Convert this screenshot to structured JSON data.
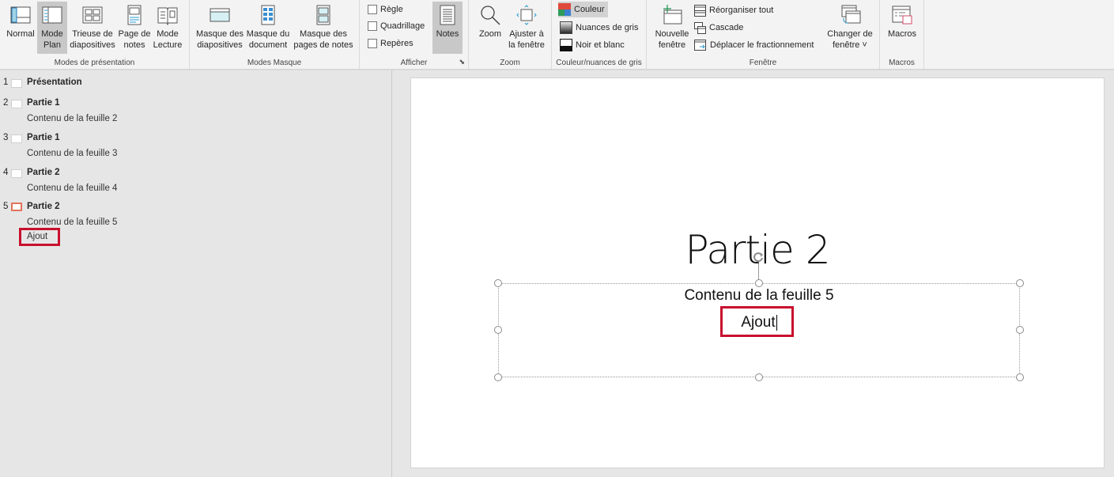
{
  "ribbon": {
    "groups": {
      "presentation_modes": {
        "label": "Modes de présentation",
        "buttons": [
          {
            "id": "normal",
            "line1": "Normal",
            "line2": "",
            "icon": "normal-view-icon",
            "active": false
          },
          {
            "id": "plan",
            "line1": "Mode",
            "line2": "Plan",
            "icon": "outline-view-icon",
            "active": true
          },
          {
            "id": "sorter",
            "line1": "Trieuse de",
            "line2": "diapositives",
            "icon": "slide-sorter-icon",
            "active": false
          },
          {
            "id": "notes_page",
            "line1": "Page de",
            "line2": "notes",
            "icon": "notes-page-icon",
            "active": false
          },
          {
            "id": "reading",
            "line1": "Mode",
            "line2": "Lecture",
            "icon": "reading-view-icon",
            "active": false
          }
        ]
      },
      "master_modes": {
        "label": "Modes Masque",
        "buttons": [
          {
            "id": "slide_master",
            "line1": "Masque des",
            "line2": "diapositives",
            "icon": "slide-master-icon"
          },
          {
            "id": "handout_master",
            "line1": "Masque du",
            "line2": "document",
            "icon": "handout-master-icon"
          },
          {
            "id": "notes_master",
            "line1": "Masque des",
            "line2": "pages de notes",
            "icon": "notes-master-icon"
          }
        ]
      },
      "show": {
        "label": "Afficher",
        "checkboxes": [
          {
            "id": "ruler",
            "label": "Règle",
            "checked": false
          },
          {
            "id": "gridlines",
            "label": "Quadrillage",
            "checked": false
          },
          {
            "id": "guides",
            "label": "Repères",
            "checked": false
          }
        ],
        "notes_button": {
          "label": "Notes",
          "icon": "notes-icon",
          "active": true
        }
      },
      "zoom": {
        "label": "Zoom",
        "buttons": [
          {
            "id": "zoom",
            "line1": "Zoom",
            "line2": "",
            "icon": "magnifier-icon"
          },
          {
            "id": "fit",
            "line1": "Ajuster à",
            "line2": "la fenêtre",
            "icon": "fit-window-icon"
          }
        ]
      },
      "color": {
        "label": "Couleur/nuances de gris",
        "options": [
          {
            "id": "color",
            "label": "Couleur",
            "icon": "color-icon",
            "active": true
          },
          {
            "id": "grayscale",
            "label": "Nuances de gris",
            "icon": "grayscale-icon",
            "active": false
          },
          {
            "id": "bw",
            "label": "Noir et blanc",
            "icon": "black-white-icon",
            "active": false
          }
        ]
      },
      "window": {
        "label": "Fenêtre",
        "new_window": {
          "line1": "Nouvelle",
          "line2": "fenêtre",
          "icon": "new-window-icon"
        },
        "small": [
          {
            "id": "arrange",
            "label": "Réorganiser tout",
            "icon": "arrange-all-icon"
          },
          {
            "id": "cascade",
            "label": "Cascade",
            "icon": "cascade-icon"
          },
          {
            "id": "split",
            "label": "Déplacer le fractionnement",
            "icon": "move-split-icon"
          }
        ],
        "switch": {
          "line1": "Changer de",
          "line2": "fenêtre ˅",
          "icon": "switch-window-icon"
        }
      },
      "macros": {
        "label": "Macros",
        "button": {
          "line1": "Macros",
          "icon": "macros-icon"
        }
      }
    }
  },
  "outline": {
    "slides": [
      {
        "num": "1",
        "title": "Présentation",
        "body": [],
        "selected": false
      },
      {
        "num": "2",
        "title": "Partie 1",
        "body": [
          "Contenu de la feuille 2"
        ],
        "selected": false
      },
      {
        "num": "3",
        "title": "Partie 1",
        "body": [
          "Contenu de la feuille 3"
        ],
        "selected": false
      },
      {
        "num": "4",
        "title": "Partie 2",
        "body": [
          "Contenu de la feuille 4"
        ],
        "selected": false
      },
      {
        "num": "5",
        "title": "Partie 2",
        "body": [
          "Contenu de la feuille 5",
          "Ajout"
        ],
        "selected": true
      }
    ]
  },
  "slide": {
    "title": "Partie 2",
    "body_line1": "Contenu de la feuille 5",
    "body_line2": "Ajout"
  },
  "colors": {
    "highlight": "#c8102e",
    "selected_thumb": "#e0735a",
    "ribbon_bg": "#f3f3f3",
    "workspace_bg": "#e6e6e6"
  }
}
